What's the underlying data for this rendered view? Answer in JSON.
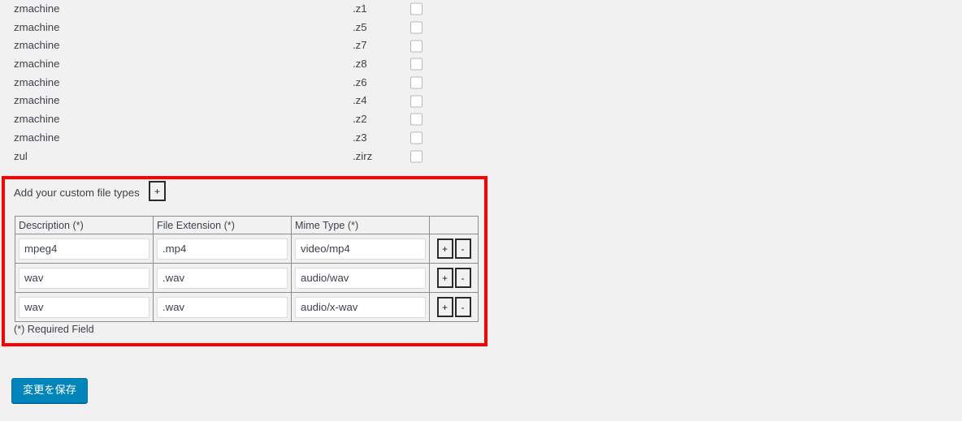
{
  "filetype_list": {
    "rows": [
      {
        "name": "zmachine",
        "extension": ".z1",
        "checked": false
      },
      {
        "name": "zmachine",
        "extension": ".z5",
        "checked": false
      },
      {
        "name": "zmachine",
        "extension": ".z7",
        "checked": false
      },
      {
        "name": "zmachine",
        "extension": ".z8",
        "checked": false
      },
      {
        "name": "zmachine",
        "extension": ".z6",
        "checked": false
      },
      {
        "name": "zmachine",
        "extension": ".z4",
        "checked": false
      },
      {
        "name": "zmachine",
        "extension": ".z2",
        "checked": false
      },
      {
        "name": "zmachine",
        "extension": ".z3",
        "checked": false
      },
      {
        "name": "zul",
        "extension": ".zirz",
        "checked": false
      }
    ]
  },
  "custom_panel": {
    "title": "Add your custom file types",
    "add_row_button_label": "+",
    "highlight_color": "#ff0000",
    "required_note": "(*) Required Field",
    "table": {
      "headers": [
        "Description (*)",
        "File Extension (*)",
        "Mime Type (*)",
        ""
      ],
      "rows": [
        {
          "description": "mpeg4",
          "extension": ".mp4",
          "mime_type": "video/mp4",
          "add_label": "+",
          "remove_label": "-"
        },
        {
          "description": "wav",
          "extension": ".wav",
          "mime_type": "audio/wav",
          "add_label": "+",
          "remove_label": "-"
        },
        {
          "description": "wav",
          "extension": ".wav",
          "mime_type": "audio/x-wav",
          "add_label": "+",
          "remove_label": "-"
        }
      ]
    }
  },
  "submit": {
    "label": "変更を保存",
    "color": "#0085ba"
  }
}
